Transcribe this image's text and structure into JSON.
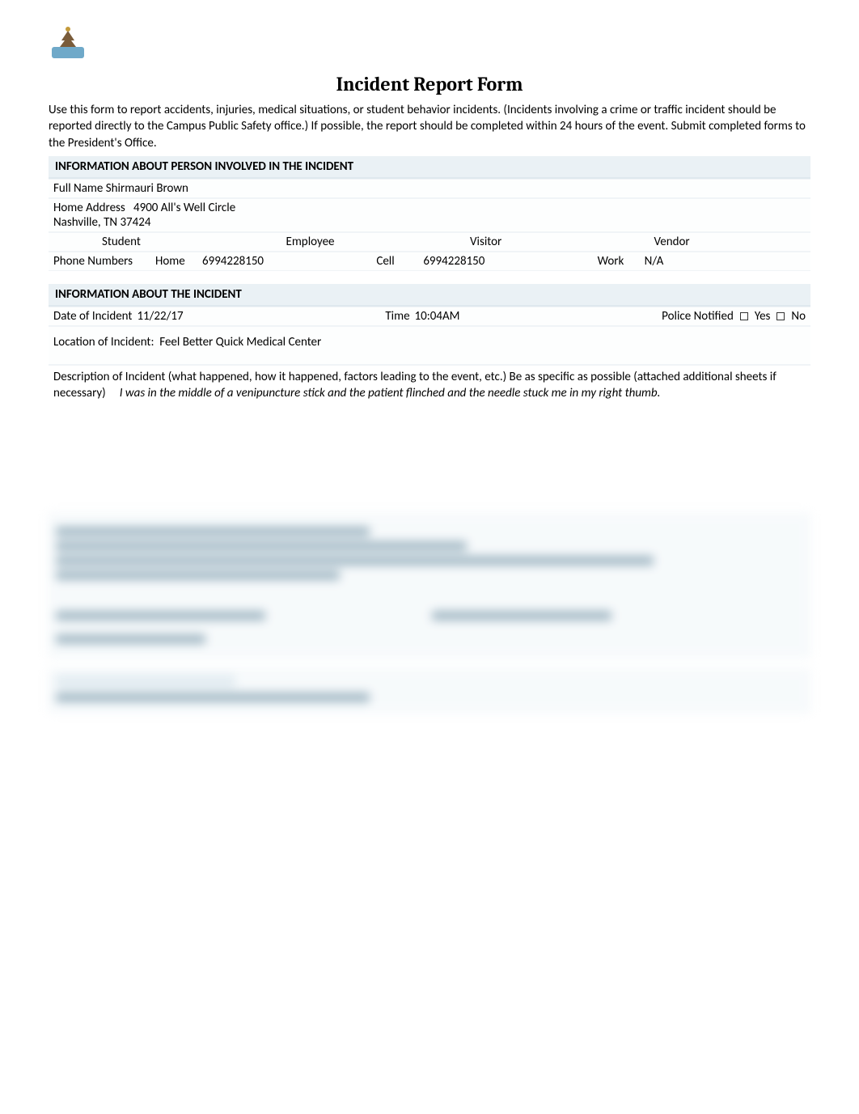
{
  "header": {
    "title": "Incident Report Form",
    "intro": "Use this form to report accidents, injuries, medical situations, or student behavior incidents. (Incidents involving a crime or traffic incident should be reported directly to the Campus Public Safety office.) If possible, the report should be completed within 24 hours of the event. Submit completed forms to the President's Office."
  },
  "person": {
    "section_title": "INFORMATION ABOUT PERSON INVOLVED IN THE INCIDENT",
    "fullname_label": "Full Name",
    "fullname_value": "Shirmauri Brown",
    "address_label": "Home Address",
    "address_line1": "4900 All's Well Circle",
    "address_line2": "Nashville, TN 37424",
    "roles": {
      "student": "Student",
      "employee": "Employee",
      "visitor": "Visitor",
      "vendor": "Vendor"
    },
    "phone_label": "Phone Numbers",
    "home_label": "Home",
    "home_value": "6994228150",
    "cell_label": "Cell",
    "cell_value": "6994228150",
    "work_label": "Work",
    "work_value": "N/A"
  },
  "incident": {
    "section_title": "INFORMATION ABOUT THE INCIDENT",
    "date_label": "Date of Incident",
    "date_value": "11/22/17",
    "time_label": "Time",
    "time_value": "10:04AM",
    "police_label": "Police Notified",
    "yes": "Yes",
    "no": "No",
    "location_label": "Location of Incident:",
    "location_value": "Feel Better Quick Medical Center",
    "desc_label": "Description of Incident (what happened, how it happened, factors leading to the event, etc.) Be as specific as possible (attached additional sheets if necessary)",
    "desc_value": "I was in the middle of a venipuncture stick and the patient flinched and the needle stuck me in my right thumb."
  }
}
